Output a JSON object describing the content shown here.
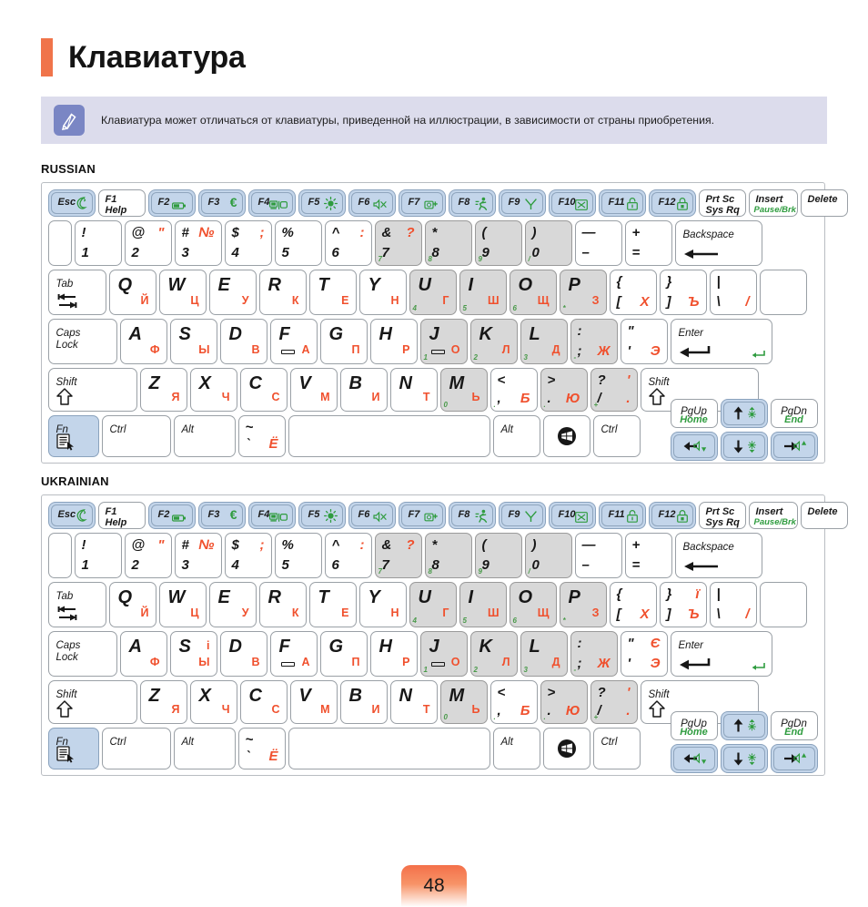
{
  "header": {
    "title": "Клавиатура"
  },
  "note": {
    "icon": "pencil-note-icon",
    "text": "Клавиатура может отличаться от клавиатуры, приведенной на иллюстрации, в зависимости от страны приобретения."
  },
  "sections": [
    {
      "label": "RUSSIAN",
      "id": "russian"
    },
    {
      "label": "UKRAINIAN",
      "id": "ukrainian"
    }
  ],
  "colors": {
    "accent_orange": "#f0744a",
    "latin_black": "#171717",
    "cyrillic_red": "#f0502d",
    "fn_green": "#2f9c3f",
    "numpad_green": "#4a9a4a",
    "fn_key_blue": "#c3d5ea",
    "note_bg": "#dcdcec",
    "note_icon_bg": "#7a86c4",
    "shaded_key": "#d8d8d8"
  },
  "keyboard": {
    "function_row": [
      {
        "name": "esc",
        "top": "Esc",
        "icon": "moon-sleep-icon",
        "blue": true
      },
      {
        "name": "f1",
        "top": "F1",
        "sub": "Help",
        "blue": false
      },
      {
        "name": "f2",
        "top": "F2",
        "icon": "battery-icon",
        "blue": true
      },
      {
        "name": "f3",
        "top": "F3",
        "icon": "euro-icon",
        "blue": true
      },
      {
        "name": "f4",
        "top": "F4",
        "icon": "display-switch-icon",
        "blue": true
      },
      {
        "name": "f5",
        "top": "F5",
        "icon": "brightness-icon",
        "blue": true
      },
      {
        "name": "f6",
        "top": "F6",
        "icon": "mute-icon",
        "blue": true
      },
      {
        "name": "f7",
        "top": "F7",
        "icon": "silent-mode-icon",
        "blue": true
      },
      {
        "name": "f8",
        "top": "F8",
        "icon": "performance-run-icon",
        "blue": true
      },
      {
        "name": "f9",
        "top": "F9",
        "icon": "wireless-antenna-icon",
        "blue": true
      },
      {
        "name": "f10",
        "top": "F10",
        "icon": "touchpad-off-icon",
        "blue": true
      },
      {
        "name": "f11",
        "top": "F11",
        "icon": "lock-open-icon",
        "blue": true
      },
      {
        "name": "f12",
        "top": "F12",
        "icon": "lock-closed-icon",
        "blue": true
      },
      {
        "name": "prtsc",
        "top": "Prt Sc",
        "sub": "Sys Rq",
        "blue": false
      },
      {
        "name": "insert",
        "top": "Insert",
        "sub_green": "Pause/Brk",
        "blue": false
      },
      {
        "name": "delete",
        "top": "Delete",
        "blue": false
      }
    ],
    "number_row": [
      {
        "name": "tilde-left-blank",
        "blank": true
      },
      {
        "name": "key-1",
        "tl": "!",
        "bl": "1"
      },
      {
        "name": "key-2",
        "tl": "@",
        "tr": "\"",
        "bl": "2"
      },
      {
        "name": "key-3",
        "tl": "#",
        "tr": "№",
        "bl": "3"
      },
      {
        "name": "key-4",
        "tl": "$",
        "tr": ";",
        "bl": "4"
      },
      {
        "name": "key-5",
        "tl": "%",
        "bl": "5"
      },
      {
        "name": "key-6",
        "tl": "^",
        "tr": ":",
        "bl": "6"
      },
      {
        "name": "key-7",
        "tl": "&",
        "tr": "?",
        "bl": "7",
        "shaded": true,
        "numpad": "7"
      },
      {
        "name": "key-8",
        "tl": "*",
        "bl": "8",
        "shaded": true,
        "numpad": "8"
      },
      {
        "name": "key-9",
        "tl": "(",
        "bl": "9",
        "shaded": true,
        "numpad": "9"
      },
      {
        "name": "key-0",
        "tl": ")",
        "bl": "0",
        "shaded": true,
        "numpad": "/"
      },
      {
        "name": "key-minus",
        "tl": "—",
        "bl": "–"
      },
      {
        "name": "key-equal",
        "tl": "+",
        "bl": "="
      },
      {
        "name": "backspace",
        "top": "Backspace",
        "icon": "backspace-arrow-icon"
      }
    ],
    "qwerty_row": [
      {
        "name": "tab",
        "top": "Tab",
        "icon": "tab-arrows-icon"
      },
      {
        "name": "key-q",
        "latin": "Q",
        "cyr": "Й"
      },
      {
        "name": "key-w",
        "latin": "W",
        "cyr": "Ц"
      },
      {
        "name": "key-e",
        "latin": "E",
        "cyr": "У"
      },
      {
        "name": "key-r",
        "latin": "R",
        "cyr": "К"
      },
      {
        "name": "key-t",
        "latin": "T",
        "cyr": "Е"
      },
      {
        "name": "key-y",
        "latin": "Y",
        "cyr": "Н"
      },
      {
        "name": "key-u",
        "latin": "U",
        "cyr": "Г",
        "shaded": true,
        "numpad": "4"
      },
      {
        "name": "key-i",
        "latin": "I",
        "cyr": "Ш",
        "shaded": true,
        "numpad": "5"
      },
      {
        "name": "key-o",
        "latin": "O",
        "cyr": "Щ",
        "shaded": true,
        "numpad": "6"
      },
      {
        "name": "key-p",
        "latin": "P",
        "cyr": "З",
        "shaded": true,
        "numpad": "*"
      },
      {
        "name": "key-bracket-left",
        "tl": "{",
        "bl": "[",
        "br": "Х"
      },
      {
        "name": "key-bracket-right",
        "tl": "}",
        "bl": "]",
        "br": "Ъ",
        "tr_ua": "ї"
      },
      {
        "name": "key-backslash",
        "tl": "|",
        "bl": "\\",
        "br": "/"
      }
    ],
    "home_row": [
      {
        "name": "caps-lock",
        "top": "Caps",
        "sub": "Lock"
      },
      {
        "name": "key-a",
        "latin": "A",
        "cyr": "Ф"
      },
      {
        "name": "key-s",
        "latin": "S",
        "cyr": "Ы",
        "tr_ua": "і"
      },
      {
        "name": "key-d",
        "latin": "D",
        "cyr": "В"
      },
      {
        "name": "key-f",
        "latin": "F",
        "cyr": "А",
        "homing": true
      },
      {
        "name": "key-g",
        "latin": "G",
        "cyr": "П"
      },
      {
        "name": "key-h",
        "latin": "H",
        "cyr": "Р"
      },
      {
        "name": "key-j",
        "latin": "J",
        "cyr": "О",
        "shaded": true,
        "numpad": "1",
        "homing": true
      },
      {
        "name": "key-k",
        "latin": "K",
        "cyr": "Л",
        "shaded": true,
        "numpad": "2"
      },
      {
        "name": "key-l",
        "latin": "L",
        "cyr": "Д",
        "shaded": true,
        "numpad": "3"
      },
      {
        "name": "key-semicolon",
        "tl": ":",
        "bl": ";",
        "br": "Ж",
        "shaded": true,
        "numpad": "-"
      },
      {
        "name": "key-quote",
        "tl": "\"",
        "bl": "'",
        "br": "Э",
        "tr_ua": "Є"
      },
      {
        "name": "enter",
        "top": "Enter",
        "icon": "enter-arrow-icon",
        "fn_icon": "enter-green-icon"
      }
    ],
    "shift_row": [
      {
        "name": "shift-left",
        "top": "Shift",
        "icon": "shift-arrow-icon"
      },
      {
        "name": "key-z",
        "latin": "Z",
        "cyr": "Я"
      },
      {
        "name": "key-x",
        "latin": "X",
        "cyr": "Ч"
      },
      {
        "name": "key-c",
        "latin": "C",
        "cyr": "С"
      },
      {
        "name": "key-v",
        "latin": "V",
        "cyr": "М"
      },
      {
        "name": "key-b",
        "latin": "B",
        "cyr": "И"
      },
      {
        "name": "key-n",
        "latin": "N",
        "cyr": "Т"
      },
      {
        "name": "key-m",
        "latin": "M",
        "cyr": "Ь",
        "shaded": true,
        "numpad": "0"
      },
      {
        "name": "key-comma",
        "tl": "<",
        "bl": ",",
        "br": "Б",
        "numpad": "."
      },
      {
        "name": "key-period",
        "tl": ">",
        "bl": ".",
        "br": "Ю",
        "shaded": true,
        "numpad": "."
      },
      {
        "name": "key-slash",
        "tl": "?",
        "tr": "'",
        "bl": "/",
        "br": ".",
        "shaded": true,
        "numpad": "+"
      },
      {
        "name": "shift-right",
        "top": "Shift",
        "icon": "shift-arrow-icon"
      }
    ],
    "bottom_row": [
      {
        "name": "fn",
        "top": "Fn",
        "icon": "fn-menu-icon",
        "blue": true
      },
      {
        "name": "ctrl-left",
        "top": "Ctrl"
      },
      {
        "name": "alt-left",
        "top": "Alt"
      },
      {
        "name": "key-grave",
        "tl": "~",
        "bl": "`",
        "br": "Ё"
      },
      {
        "name": "space",
        "top": ""
      },
      {
        "name": "alt-right",
        "top": "Alt"
      },
      {
        "name": "windows",
        "icon": "windows-logo-icon"
      },
      {
        "name": "ctrl-right",
        "top": "Ctrl"
      }
    ],
    "nav_cluster": [
      {
        "name": "pgup-home",
        "top": "PgUp",
        "sub_green": "Home"
      },
      {
        "name": "arrow-up-brightness",
        "icon": "arrow-up-icon",
        "fn_icon": "brightness-up-icon",
        "blue": true
      },
      {
        "name": "pgdn-end",
        "top": "PgDn",
        "sub_green": "End"
      },
      {
        "name": "arrow-left-volume-down",
        "icon": "arrow-left-icon",
        "fn_icon": "volume-down-icon",
        "blue": true
      },
      {
        "name": "arrow-down-brightness",
        "icon": "arrow-down-icon",
        "fn_icon": "brightness-down-icon",
        "blue": true
      },
      {
        "name": "arrow-right-volume-up",
        "icon": "arrow-right-icon",
        "fn_icon": "volume-up-icon",
        "blue": true
      }
    ]
  },
  "footer": {
    "page_number": "48"
  }
}
